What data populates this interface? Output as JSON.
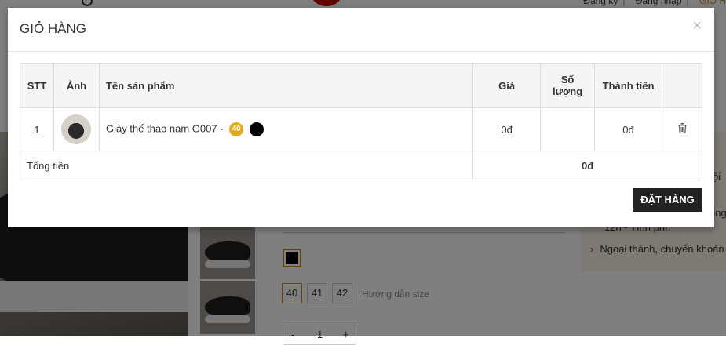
{
  "top_links": {
    "register": "Đăng ký",
    "login": "Đăng nhập",
    "accent": "GIỎ H"
  },
  "product": {
    "sizes": [
      "40",
      "41",
      "42"
    ],
    "size_guide": "Hướng dẫn size",
    "qty_minus": "-",
    "qty_value": "1",
    "qty_plus": "+",
    "selected_color": "#000000"
  },
  "info_panel": {
    "line1": "ội",
    "line2": "ong",
    "line3": "12h - Tính phí.",
    "line4": "Ngoại thành, chuyển khoản t"
  },
  "modal": {
    "title": "GIỎ HÀNG",
    "close": "×",
    "columns": {
      "index": "STT",
      "image": "Ảnh",
      "name": "Tên sản phẩm",
      "price": "Giá",
      "quantity": "Số lượng",
      "subtotal": "Thành tiền"
    },
    "items": [
      {
        "index": "1",
        "name": "Giày thể thao nam G007 -",
        "size": "40",
        "color": "#000000",
        "price": "0đ",
        "quantity": "",
        "subtotal": "0đ"
      }
    ],
    "total_label": "Tổng tiền",
    "total_value": "0đ",
    "order_button": "ĐẶT HÀNG"
  },
  "colors": {
    "accent": "#c38c16",
    "badge": "#e0a922",
    "button": "#222222",
    "overlay": "rgba(0,0,0,0.5)"
  },
  "icons": [
    "search-icon",
    "close-icon",
    "trash-icon",
    "chevron-right-icon"
  ]
}
